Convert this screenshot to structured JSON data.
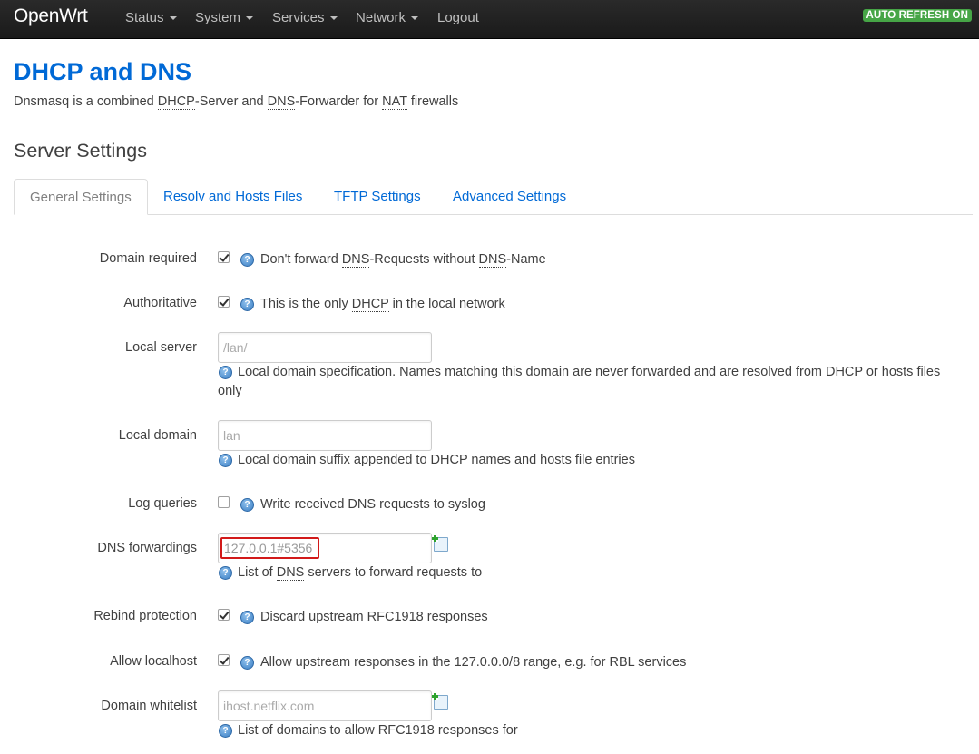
{
  "navbar": {
    "brand": "OpenWrt",
    "items": [
      {
        "label": "Status"
      },
      {
        "label": "System"
      },
      {
        "label": "Services"
      },
      {
        "label": "Network"
      },
      {
        "label": "Logout"
      }
    ],
    "auto_refresh": "AUTO REFRESH ON"
  },
  "page": {
    "title": "DHCP and DNS",
    "desc_parts": [
      "Dnsmasq is a combined ",
      "DHCP",
      "-Server and ",
      "DNS",
      "-Forwarder for ",
      "NAT",
      " firewalls"
    ],
    "section_title": "Server Settings"
  },
  "tabs": [
    {
      "label": "General Settings",
      "active": true
    },
    {
      "label": "Resolv and Hosts Files",
      "active": false
    },
    {
      "label": "TFTP Settings",
      "active": false
    },
    {
      "label": "Advanced Settings",
      "active": false
    }
  ],
  "fields": {
    "domain_required": {
      "label": "Domain required",
      "checked": true,
      "help_parts": [
        "Don't forward ",
        "DNS",
        "-Requests without ",
        "DNS",
        "-Name"
      ]
    },
    "authoritative": {
      "label": "Authoritative",
      "checked": true,
      "help_parts": [
        "This is the only ",
        "DHCP",
        " in the local network"
      ]
    },
    "local_server": {
      "label": "Local server",
      "value": "",
      "placeholder": "/lan/",
      "help_line1": "Local domain specification. Names matching this domain are never forwarded and are resolved from DHCP or hosts files",
      "help_line2": "only"
    },
    "local_domain": {
      "label": "Local domain",
      "value": "",
      "placeholder": "lan",
      "help": "Local domain suffix appended to DHCP names and hosts file entries"
    },
    "log_queries": {
      "label": "Log queries",
      "checked": false,
      "help": "Write received DNS requests to syslog"
    },
    "dns_forwardings": {
      "label": "DNS forwardings",
      "value": "127.0.0.1#5356",
      "help_parts": [
        "List of ",
        "DNS",
        " servers to forward requests to"
      ]
    },
    "rebind_protection": {
      "label": "Rebind protection",
      "checked": true,
      "help": "Discard upstream RFC1918 responses"
    },
    "allow_localhost": {
      "label": "Allow localhost",
      "checked": true,
      "help": "Allow upstream responses in the 127.0.0.0/8 range, e.g. for RBL services"
    },
    "domain_whitelist": {
      "label": "Domain whitelist",
      "value": "",
      "placeholder": "ihost.netflix.com",
      "help": "List of domains to allow RFC1918 responses for"
    }
  },
  "colors": {
    "navbar_bg": "#222222",
    "title_blue": "#0069d6",
    "badge_green": "#46a546",
    "highlight_red": "#d21a1a"
  }
}
